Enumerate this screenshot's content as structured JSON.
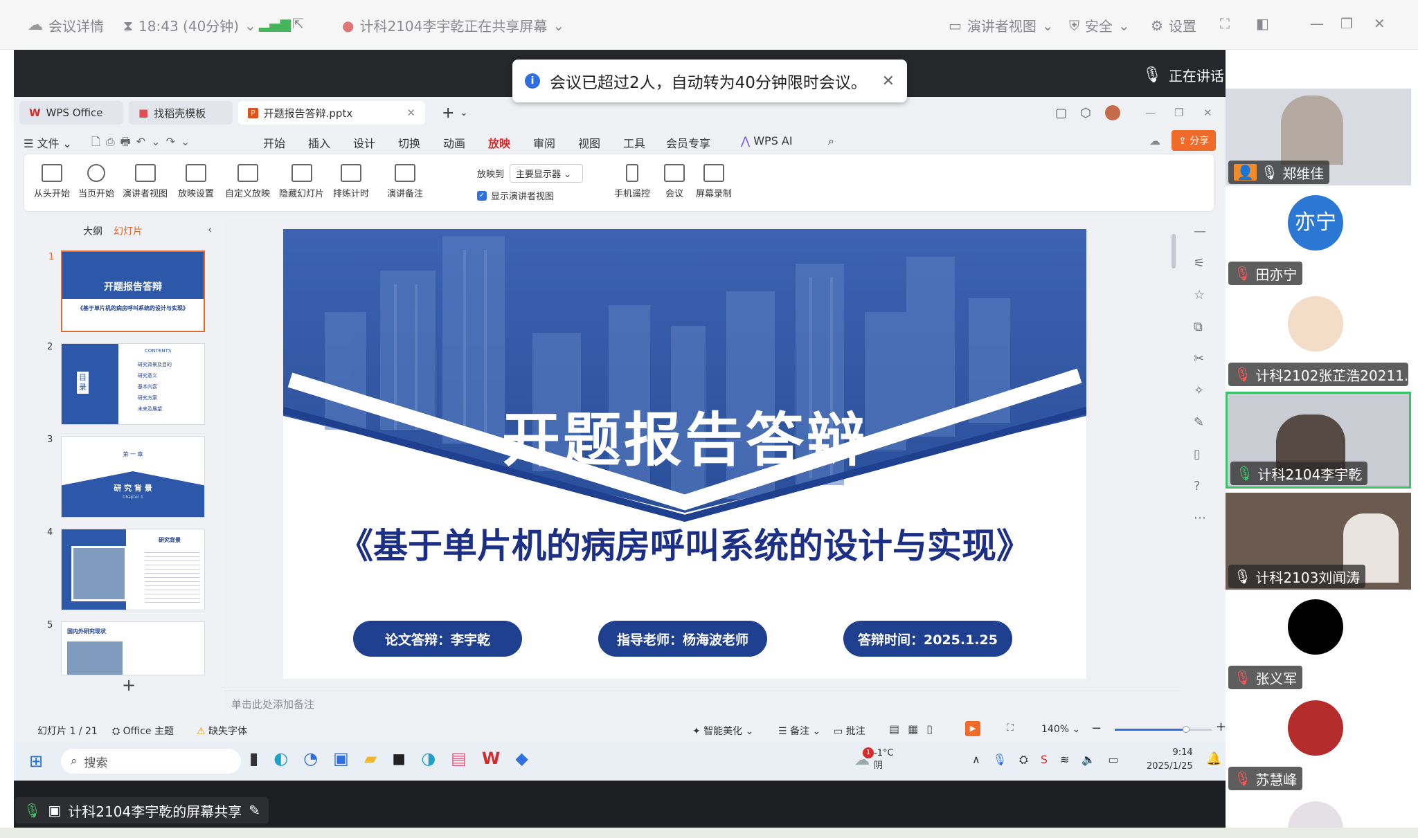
{
  "meeting": {
    "details": "会议详情",
    "timer": "18:43 (40分钟)",
    "sharing_status": "计科2104李宇乾正在共享屏幕",
    "presenter_view": "演讲者视图",
    "security": "安全",
    "settings": "设置"
  },
  "notice": {
    "text": "会议已超过2人，自动转为40分钟限时会议。"
  },
  "speaking": {
    "label": "正在讲话:",
    "name": "计科2104李宇乾;"
  },
  "wps": {
    "tabs": [
      {
        "label": "WPS Office"
      },
      {
        "label": "找稻壳模板"
      },
      {
        "label": "开题报告答辩.pptx"
      }
    ],
    "menu": [
      "文件",
      "开始",
      "插入",
      "设计",
      "切换",
      "动画",
      "放映",
      "审阅",
      "视图",
      "工具",
      "会员专享",
      "WPS AI"
    ],
    "active_menu": "放映",
    "share_button": "分享",
    "ribbon": {
      "from_start": "从头开始",
      "from_current": "当页开始",
      "presenter_view": "演讲者视图",
      "show_settings": "放映设置",
      "custom_show": "自定义放映",
      "hide_slide": "隐藏幻灯片",
      "rehearse": "排练计时",
      "speaker_notes": "演讲备注",
      "show_on_label": "放映到",
      "show_on_value": "主要显示器",
      "show_presenter_checkbox": "显示演讲者视图",
      "phone_remote": "手机遥控",
      "meeting": "会议",
      "screen_record": "屏幕录制"
    },
    "panel": {
      "outline_tab": "大纲",
      "slides_tab": "幻灯片",
      "slide_numbers": [
        "1",
        "2",
        "3",
        "4",
        "5"
      ]
    },
    "thumbs": {
      "t1_title": "开题报告答辩",
      "t1_sub": "《基于单片机的病房呼叫系统的设计与实现》",
      "t2_contents": "CONTENTS",
      "t2_mu": "目",
      "t2_lu": "录",
      "t2_items": [
        "研究背景及目的",
        "研究意义",
        "基本内容",
        "研究方案",
        "未来及展望"
      ],
      "t3_chapter": "第 一 章",
      "t3_title": "研 究 背 景",
      "t3_sub": "Chapter 1",
      "t4_title": "研究背景",
      "t5_title": "国内外研究现状"
    },
    "slide": {
      "title": "开题报告答辩",
      "subtitle": "《基于单片机的病房呼叫系统的设计与实现》",
      "pills": [
        "论文答辩：李宇乾",
        "指导老师：杨海波老师",
        "答辩时间：2025.1.25"
      ]
    },
    "notes_placeholder": "单击此处添加备注",
    "status": {
      "slide_count": "幻灯片 1 / 21",
      "theme": "Office 主题",
      "missing_font": "缺失字体",
      "smart_beautify": "智能美化",
      "notes": "备注",
      "comments": "批注",
      "zoom": "140%"
    }
  },
  "taskbar": {
    "search_placeholder": "搜索",
    "weather_temp": "-1°C",
    "weather_cond": "阴",
    "weather_badge": "1",
    "time": "9:14",
    "date": "2025/1/25"
  },
  "share_label": "计科2104李宇乾的屏幕共享",
  "participants": [
    {
      "name": "郑维佳"
    },
    {
      "name": "田亦宁",
      "avatar_text": "亦宁"
    },
    {
      "name": "计科2102张芷浩20211..."
    },
    {
      "name": "计科2104李宇乾"
    },
    {
      "name": "计科2103刘闻涛"
    },
    {
      "name": "张义军"
    },
    {
      "name": "苏慧峰"
    }
  ],
  "colors": {
    "accent": "#2d57a8",
    "wps_red": "#d72b2b",
    "active_speaker": "#3fc06a",
    "slide_blue": "#1f3f8f"
  }
}
